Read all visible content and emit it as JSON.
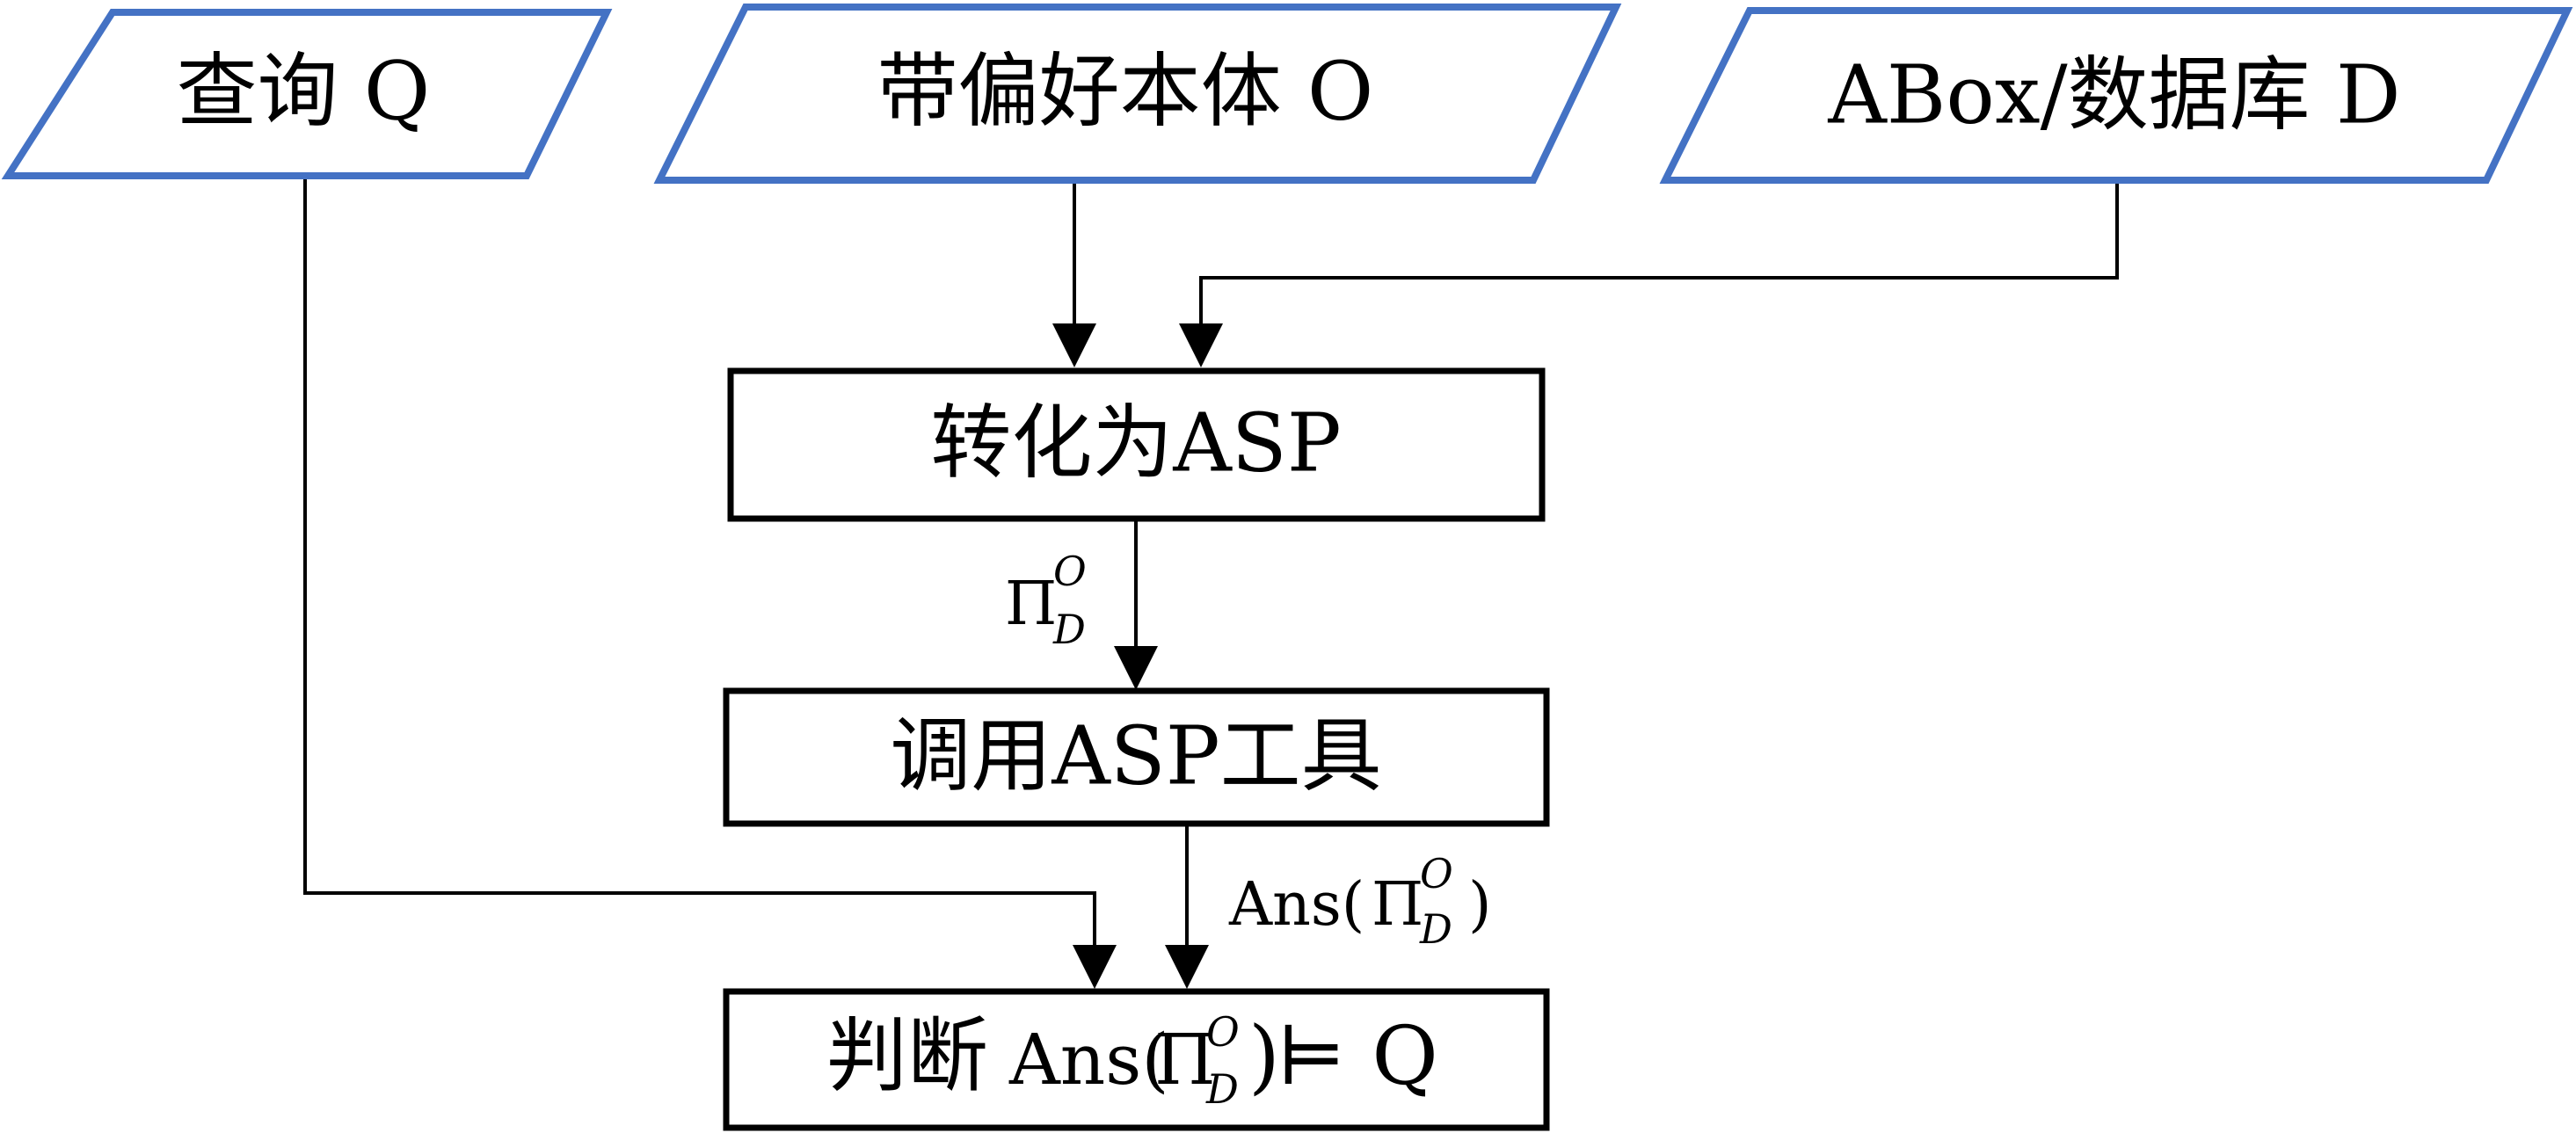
{
  "inputs": {
    "query": "查询 Q",
    "ontology": "带偏好本体 O",
    "abox": "ABox/数据库 D"
  },
  "process": {
    "convert": "转化为ASP",
    "invoke": "调用ASP工具",
    "judge_prefix": "判断 ",
    "judge_suffix": " ⊨ Q"
  },
  "program": {
    "base": "Π",
    "superscript": "O",
    "subscript": "D"
  },
  "answer": {
    "open": "Ans(",
    "close": ")"
  },
  "colors": {
    "io_border": "#4472C4",
    "process_border": "#000000",
    "connector": "#000000"
  }
}
